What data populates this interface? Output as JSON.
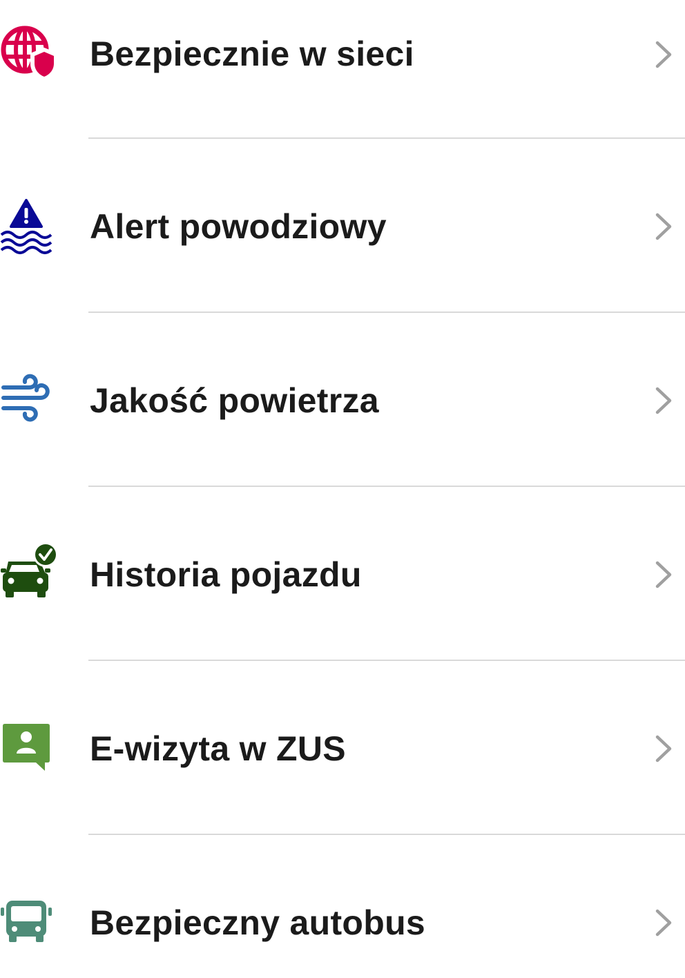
{
  "items": [
    {
      "label": "Bezpiecznie w sieci",
      "icon": "globe-shield-icon",
      "color": "#D9004C"
    },
    {
      "label": "Alert powodziowy",
      "icon": "flood-alert-icon",
      "color": "#0A0A96"
    },
    {
      "label": "Jakość powietrza",
      "icon": "wind-icon",
      "color": "#2E6DB4"
    },
    {
      "label": "Historia pojazdu",
      "icon": "car-check-icon",
      "color": "#1E4D0F"
    },
    {
      "label": "E-wizyta w ZUS",
      "icon": "person-chat-icon",
      "color": "#5E9A3E"
    },
    {
      "label": "Bezpieczny autobus",
      "icon": "bus-icon",
      "color": "#4E8C78"
    }
  ],
  "chevron_icon": "chevron-right-icon",
  "chevron_color": "#A0A0A0",
  "divider_color": "#D9D9D9"
}
